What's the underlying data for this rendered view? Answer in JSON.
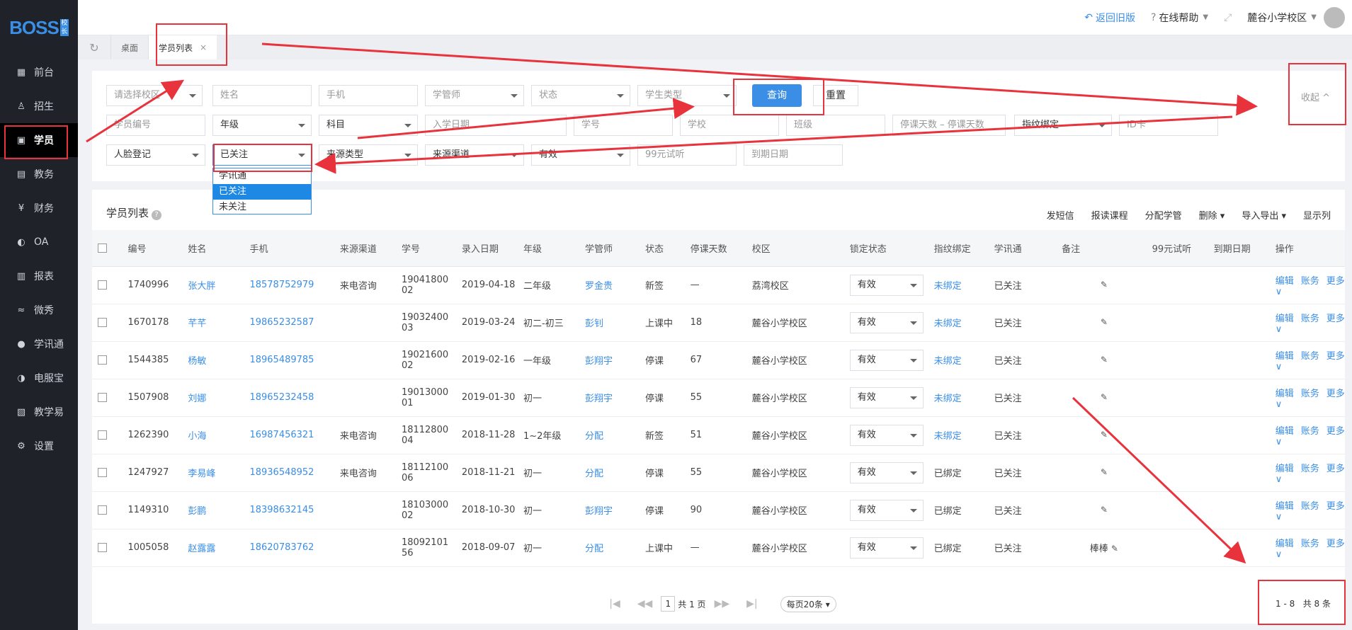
{
  "brand": {
    "logo": "BOSS",
    "tag": "校长"
  },
  "sidebar": {
    "items": [
      {
        "label": "前台",
        "icon": "calendar-icon"
      },
      {
        "label": "招生",
        "icon": "user-add-icon"
      },
      {
        "label": "学员",
        "icon": "student-icon",
        "active": true
      },
      {
        "label": "教务",
        "icon": "book-icon"
      },
      {
        "label": "财务",
        "icon": "yen-icon"
      },
      {
        "label": "OA",
        "icon": "toggle-icon"
      },
      {
        "label": "报表",
        "icon": "bar-chart-icon"
      },
      {
        "label": "微秀",
        "icon": "wave-icon"
      },
      {
        "label": "学讯通",
        "icon": "pin-icon"
      },
      {
        "label": "电服宝",
        "icon": "phone-icon"
      },
      {
        "label": "教学易",
        "icon": "teach-icon"
      },
      {
        "label": "设置",
        "icon": "gear-icon"
      }
    ]
  },
  "topbar": {
    "back": "返回旧版",
    "help": "在线帮助",
    "campus": "麓谷小学校区"
  },
  "tabs": {
    "desktop": "桌面",
    "current": "学员列表"
  },
  "filters": {
    "campus": "请选择校区",
    "name": "姓名",
    "phone": "手机",
    "manager": "学管师",
    "status": "状态",
    "student_type": "学生类型",
    "query": "查询",
    "reset": "重置",
    "collapse": "收起",
    "student_no": "学员编号",
    "grade": "年级",
    "subject": "科目",
    "enroll_date": "入学日期",
    "student_id": "学号",
    "school": "学校",
    "class": "班级",
    "pause_from": "停课天数",
    "pause_sep": "–",
    "pause_to": "停课天数",
    "fingerprint": "指纹绑定",
    "id_card": "ID卡",
    "face": "人脸登记",
    "follow": "已关注",
    "source_type": "来源类型",
    "source_channel": "来源渠道",
    "valid": "有效",
    "trial": "99元试听",
    "expire": "到期日期"
  },
  "dropdown": {
    "options": [
      "学讯通",
      "已关注",
      "未关注"
    ],
    "selected": "已关注"
  },
  "list": {
    "title": "学员列表",
    "actions": [
      "发短信",
      "报读课程",
      "分配学管",
      "删除 ▾",
      "导入导出 ▾",
      "显示列"
    ],
    "columns": [
      "编号",
      "姓名",
      "手机",
      "来源渠道",
      "学号",
      "录入日期",
      "年级",
      "学管师",
      "状态",
      "停课天数",
      "校区",
      "锁定状态",
      "指纹绑定",
      "学讯通",
      "备注",
      "99元试听",
      "到期日期",
      "操作"
    ],
    "rows": [
      {
        "id": "1740996",
        "name": "张大胖",
        "phone": "18578752979",
        "source": "来电咨询",
        "sno1": "19041800",
        "sno2": "02",
        "date": "2019-04-18",
        "grade": "二年级",
        "manager": "罗金贵",
        "status": "新签",
        "pause": "—",
        "campus": "荔湾校区",
        "lock": "有效",
        "finger": "未绑定",
        "xxt": "已关注",
        "note": ""
      },
      {
        "id": "1670178",
        "name": "芊芊",
        "phone": "19865232587",
        "source": "",
        "sno1": "19032400",
        "sno2": "03",
        "date": "2019-03-24",
        "grade": "初二-初三",
        "manager": "彭钊",
        "status": "上课中",
        "pause": "18",
        "campus": "麓谷小学校区",
        "lock": "有效",
        "finger": "未绑定",
        "xxt": "已关注",
        "note": ""
      },
      {
        "id": "1544385",
        "name": "杨敏",
        "phone": "18965489785",
        "source": "",
        "sno1": "19021600",
        "sno2": "02",
        "date": "2019-02-16",
        "grade": "一年级",
        "manager": "彭翔宇",
        "status": "停课",
        "pause": "67",
        "campus": "麓谷小学校区",
        "lock": "有效",
        "finger": "未绑定",
        "xxt": "已关注",
        "note": ""
      },
      {
        "id": "1507908",
        "name": "刘娜",
        "phone": "18965232458",
        "source": "",
        "sno1": "19013000",
        "sno2": "01",
        "date": "2019-01-30",
        "grade": "初一",
        "manager": "彭翔宇",
        "status": "停课",
        "pause": "55",
        "campus": "麓谷小学校区",
        "lock": "有效",
        "finger": "未绑定",
        "xxt": "已关注",
        "note": ""
      },
      {
        "id": "1262390",
        "name": "小海",
        "phone": "16987456321",
        "source": "来电咨询",
        "sno1": "18112800",
        "sno2": "04",
        "date": "2018-11-28",
        "grade": "1~2年级",
        "manager": "分配",
        "status": "新签",
        "pause": "51",
        "campus": "麓谷小学校区",
        "lock": "有效",
        "finger": "未绑定",
        "xxt": "已关注",
        "note": ""
      },
      {
        "id": "1247927",
        "name": "李易峰",
        "phone": "18936548952",
        "source": "来电咨询",
        "sno1": "18112100",
        "sno2": "06",
        "date": "2018-11-21",
        "grade": "初一",
        "manager": "分配",
        "status": "停课",
        "pause": "55",
        "campus": "麓谷小学校区",
        "lock": "有效",
        "finger": "已绑定",
        "xxt": "已关注",
        "note": ""
      },
      {
        "id": "1149310",
        "name": "彭鹏",
        "phone": "18398632145",
        "source": "",
        "sno1": "18103000",
        "sno2": "02",
        "date": "2018-10-30",
        "grade": "初一",
        "manager": "彭翔宇",
        "status": "停课",
        "pause": "90",
        "campus": "麓谷小学校区",
        "lock": "有效",
        "finger": "已绑定",
        "xxt": "已关注",
        "note": ""
      },
      {
        "id": "1005058",
        "name": "赵露露",
        "phone": "18620783762",
        "source": "",
        "sno1": "18092101",
        "sno2": "56",
        "date": "2018-09-07",
        "grade": "初一",
        "manager": "分配",
        "status": "上课中",
        "pause": "—",
        "campus": "麓谷小学校区",
        "lock": "有效",
        "finger": "已绑定",
        "xxt": "已关注",
        "note": "棒棒"
      }
    ],
    "ops": [
      "编辑",
      "账务",
      "更多 ∨"
    ]
  },
  "pager": {
    "page": "1",
    "total_pages": "共 1 页",
    "page_size": "每页20条",
    "range": "1 - 8",
    "total": "共 8 条"
  },
  "colors": {
    "accent": "#3a8ee6",
    "annotation": "#e8323c",
    "sidebar": "#1f2229"
  }
}
